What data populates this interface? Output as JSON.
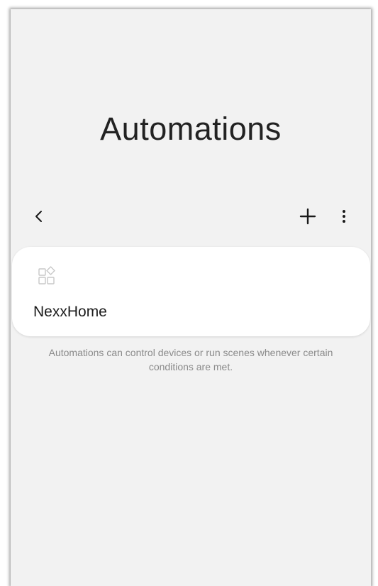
{
  "header": {
    "title": "Automations"
  },
  "toolbar": {
    "back_icon": "chevron-left-icon",
    "add_icon": "plus-icon",
    "more_icon": "more-vertical-icon"
  },
  "automations": [
    {
      "name": "NexxHome",
      "icon": "apps-grid-icon"
    }
  ],
  "hint": {
    "text": "Automations can control devices or run scenes whenever certain conditions are met."
  },
  "colors": {
    "background": "#f2f2f2",
    "card": "#ffffff",
    "text_primary": "#1a1a1a",
    "text_secondary": "#8a8a8a"
  }
}
